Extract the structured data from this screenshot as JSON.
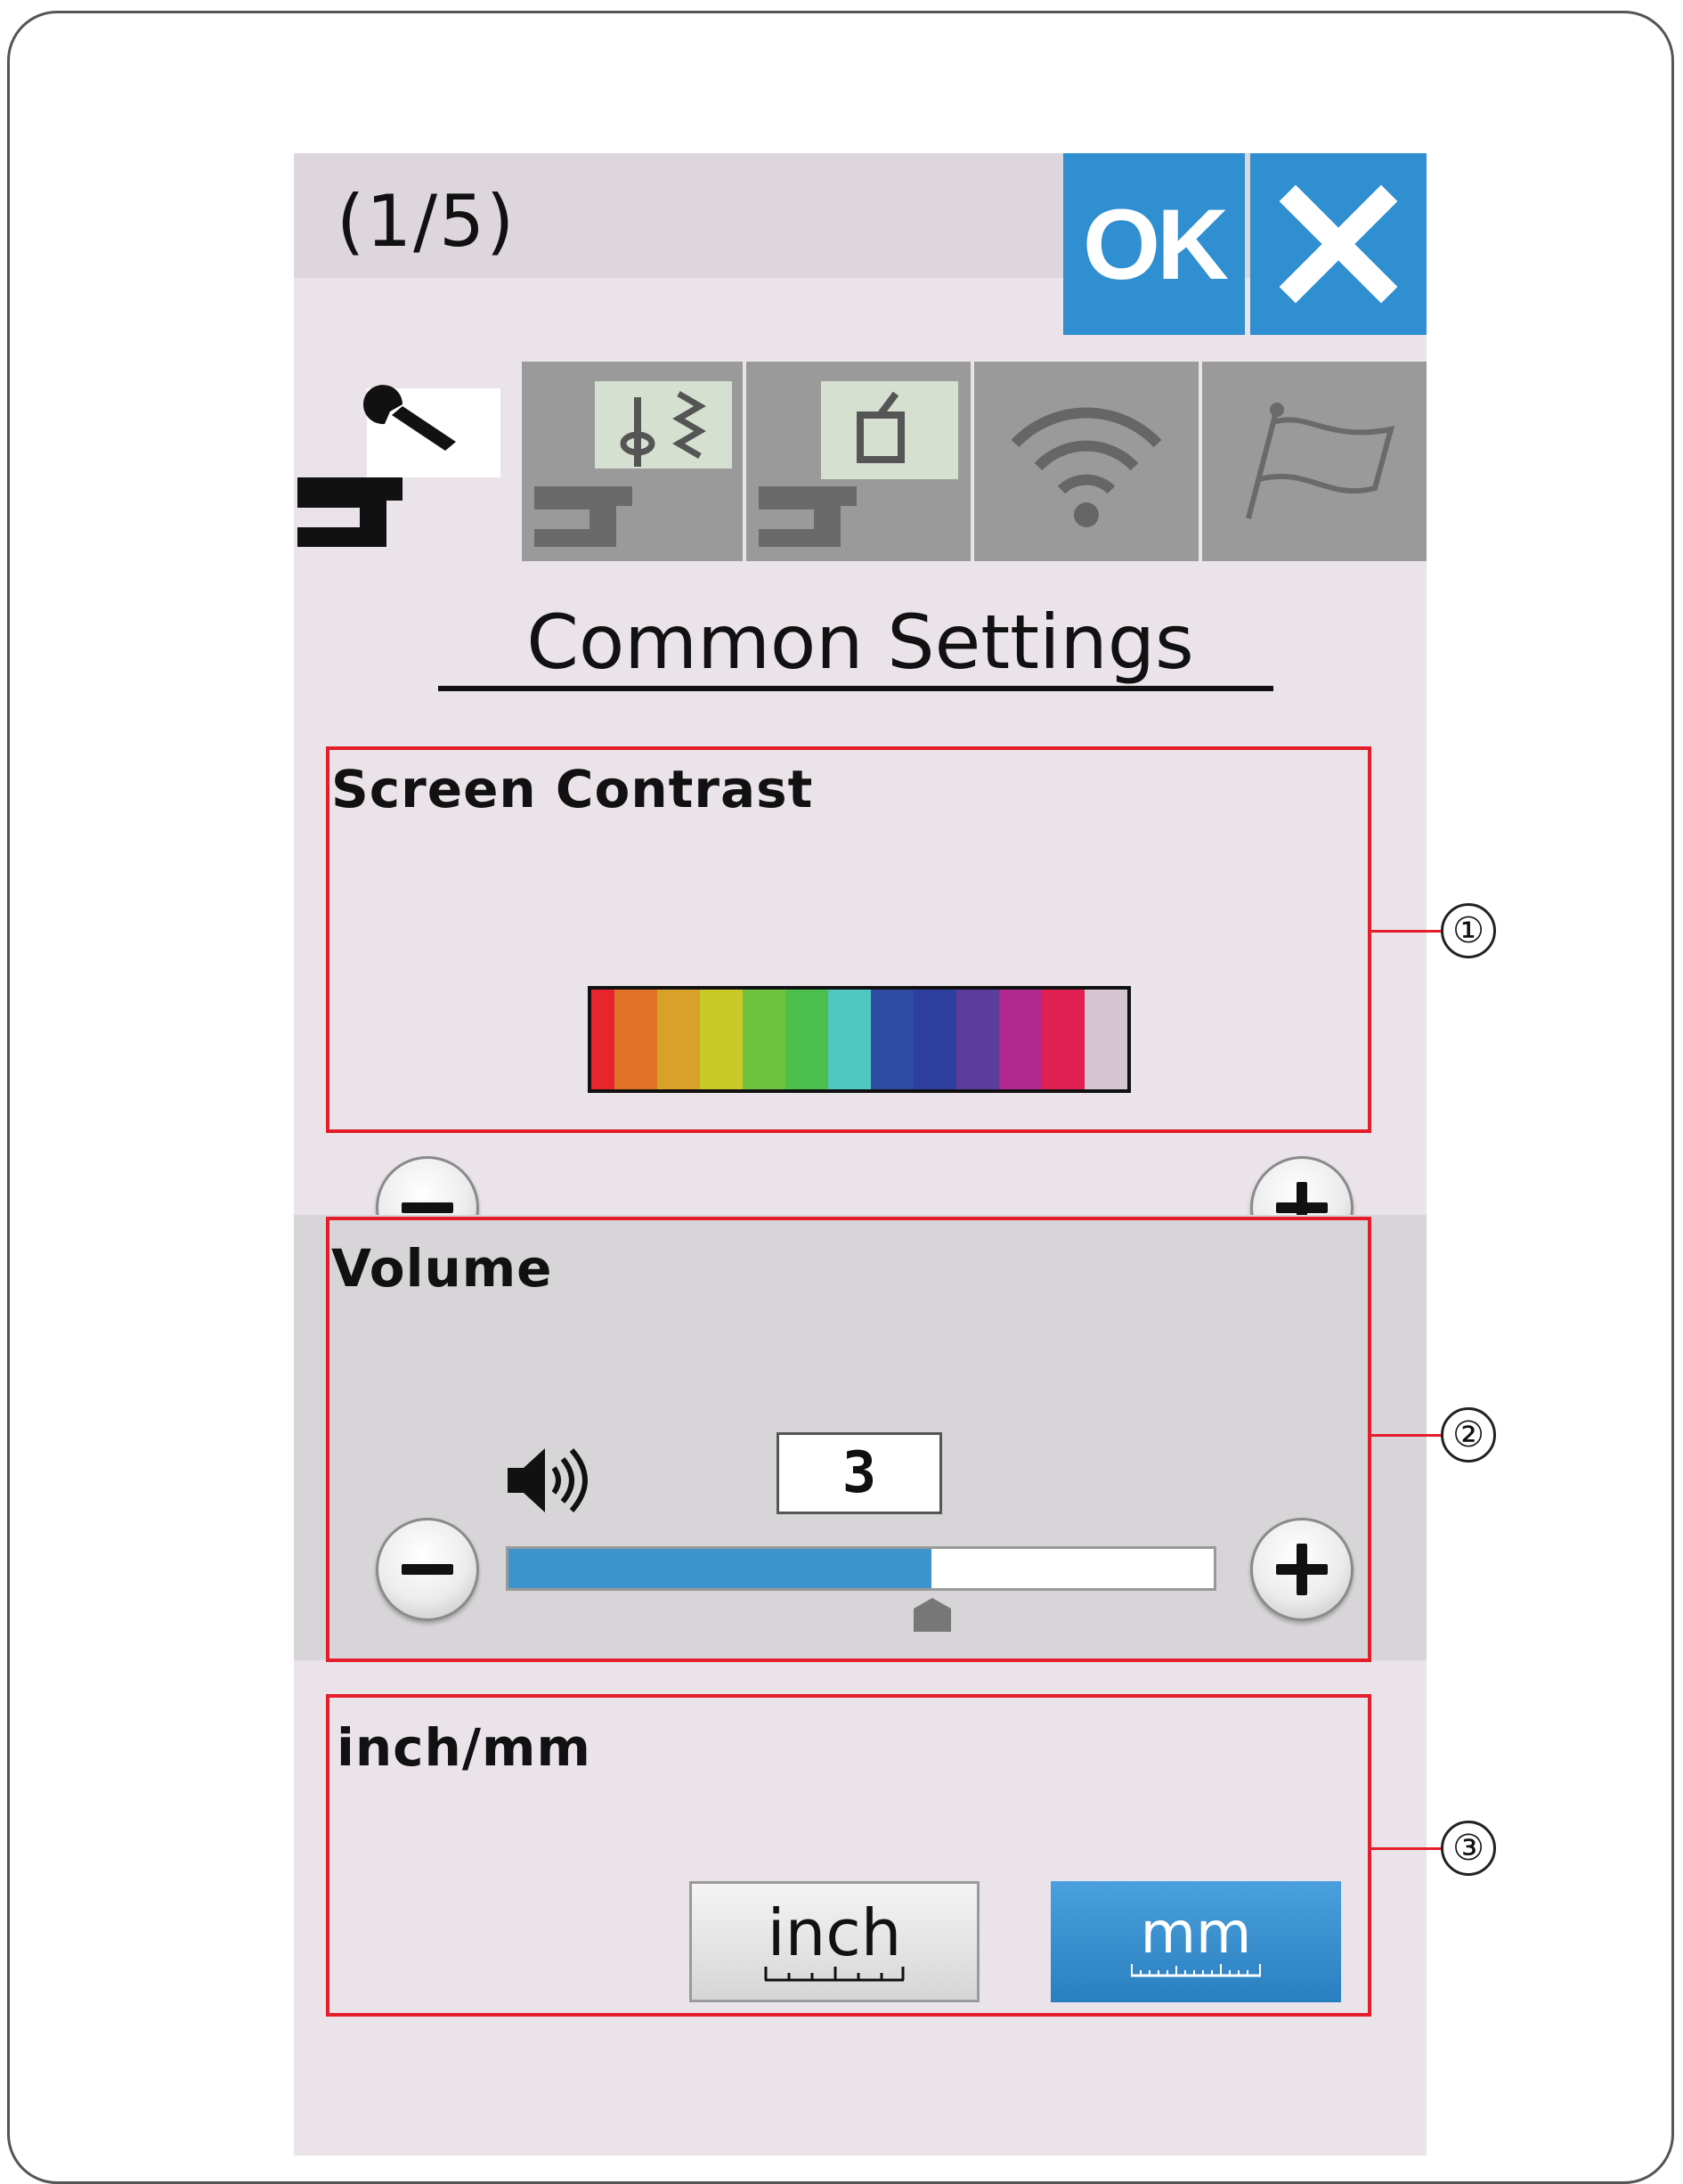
{
  "screen": {
    "page_indicator": "(1/5)",
    "ok_label": "OK",
    "close_icon": "close-x-icon",
    "title": "Common Settings"
  },
  "tabs": [
    {
      "icon": "machine-wrench-icon",
      "active": true
    },
    {
      "icon": "machine-stitch-icon",
      "active": false
    },
    {
      "icon": "machine-embroidery-icon",
      "active": false
    },
    {
      "icon": "wifi-icon",
      "active": false
    },
    {
      "icon": "flag-icon",
      "active": false
    }
  ],
  "screen_contrast": {
    "label": "Screen Contrast",
    "colors": [
      "#e8242c",
      "#df7227",
      "#d9a12a",
      "#c9c92a",
      "#6ec43c",
      "#4cbf4c",
      "#4ec8c0",
      "#2e4da2",
      "#2e3fa0",
      "#5b3d9e",
      "#b1288f",
      "#e01f52",
      "#d5c6d2"
    ]
  },
  "volume": {
    "label": "Volume",
    "value": "3",
    "level_fraction": 0.6,
    "speaker_icon": "speaker-icon"
  },
  "units": {
    "label": "inch/mm",
    "inch_label": "inch",
    "mm_label": "mm",
    "selected": "mm"
  },
  "callouts": [
    "①",
    "②",
    "③"
  ],
  "accent_color": "#2f8fd0",
  "callout_color": "#e31e2a"
}
